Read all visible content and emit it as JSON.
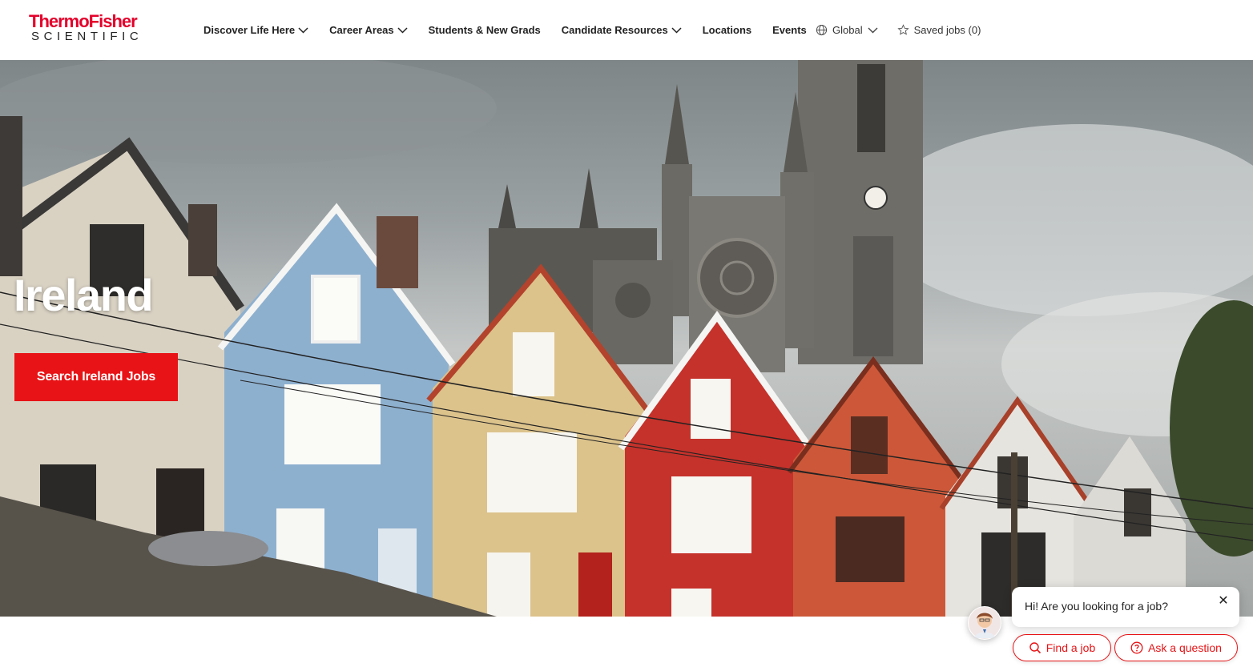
{
  "brand": {
    "name_top": "ThermoFisher",
    "name_bottom": "SCIENTIFIC",
    "color": "#e4002b"
  },
  "nav": {
    "items": [
      {
        "label": "Discover Life Here",
        "dropdown": true
      },
      {
        "label": "Career Areas",
        "dropdown": true
      },
      {
        "label": "Students & New Grads",
        "dropdown": false
      },
      {
        "label": "Candidate Resources",
        "dropdown": true
      },
      {
        "label": "Locations",
        "dropdown": false
      },
      {
        "label": "Events",
        "dropdown": false
      }
    ]
  },
  "utility": {
    "region_label": "Global",
    "region_icon": "globe-icon",
    "saved_jobs_label": "Saved jobs (0)",
    "saved_icon": "star-icon"
  },
  "hero": {
    "title": "Ireland",
    "cta_label": "Search Ireland Jobs",
    "cta_color": "#e71316"
  },
  "chat": {
    "message": "Hi! Are you looking for a job?",
    "close_label": "✕",
    "find_label": "Find a job",
    "find_icon": "search-icon",
    "ask_label": "Ask a question",
    "ask_icon": "question-icon"
  }
}
